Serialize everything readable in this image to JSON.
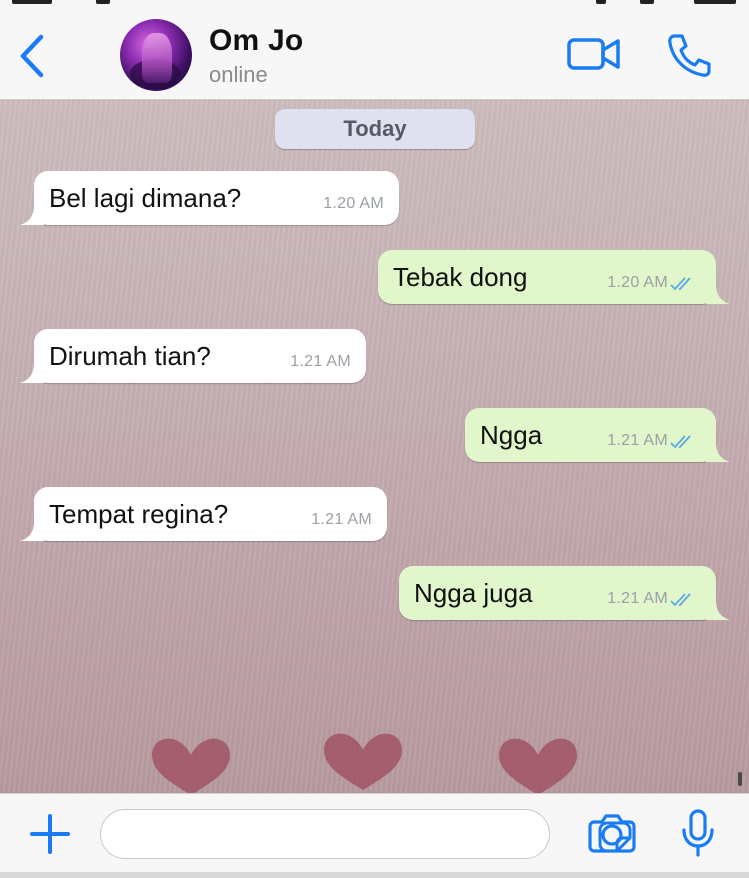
{
  "header": {
    "contact_name": "Om Jo",
    "contact_status": "online",
    "icons": [
      "chevron-left-icon",
      "video-camera-icon",
      "phone-icon"
    ]
  },
  "chat": {
    "date_label": "Today",
    "messages": [
      {
        "direction": "incoming",
        "text": "Bel lagi dimana?",
        "time": "1.20 AM"
      },
      {
        "direction": "outgoing",
        "text": "Tebak dong",
        "time": "1.20 AM",
        "status": "read"
      },
      {
        "direction": "incoming",
        "text": "Dirumah tian?",
        "time": "1.21 AM"
      },
      {
        "direction": "outgoing",
        "text": "Ngga",
        "time": "1.21 AM",
        "status": "read"
      },
      {
        "direction": "incoming",
        "text": "Tempat regina?",
        "time": "1.21 AM"
      },
      {
        "direction": "outgoing",
        "text": "Ngga juga",
        "time": "1.21 AM",
        "status": "read"
      }
    ]
  },
  "input": {
    "value": "",
    "placeholder": "",
    "icons": [
      "plus-icon",
      "sticker-icon",
      "camera-icon",
      "microphone-icon"
    ]
  },
  "colors": {
    "accent": "#1a7cf5",
    "incoming_bubble": "#ffffff",
    "outgoing_bubble": "#e1f7cb",
    "read_ticks": "#5aa9e6",
    "timestamp": "#9aa0a6"
  }
}
